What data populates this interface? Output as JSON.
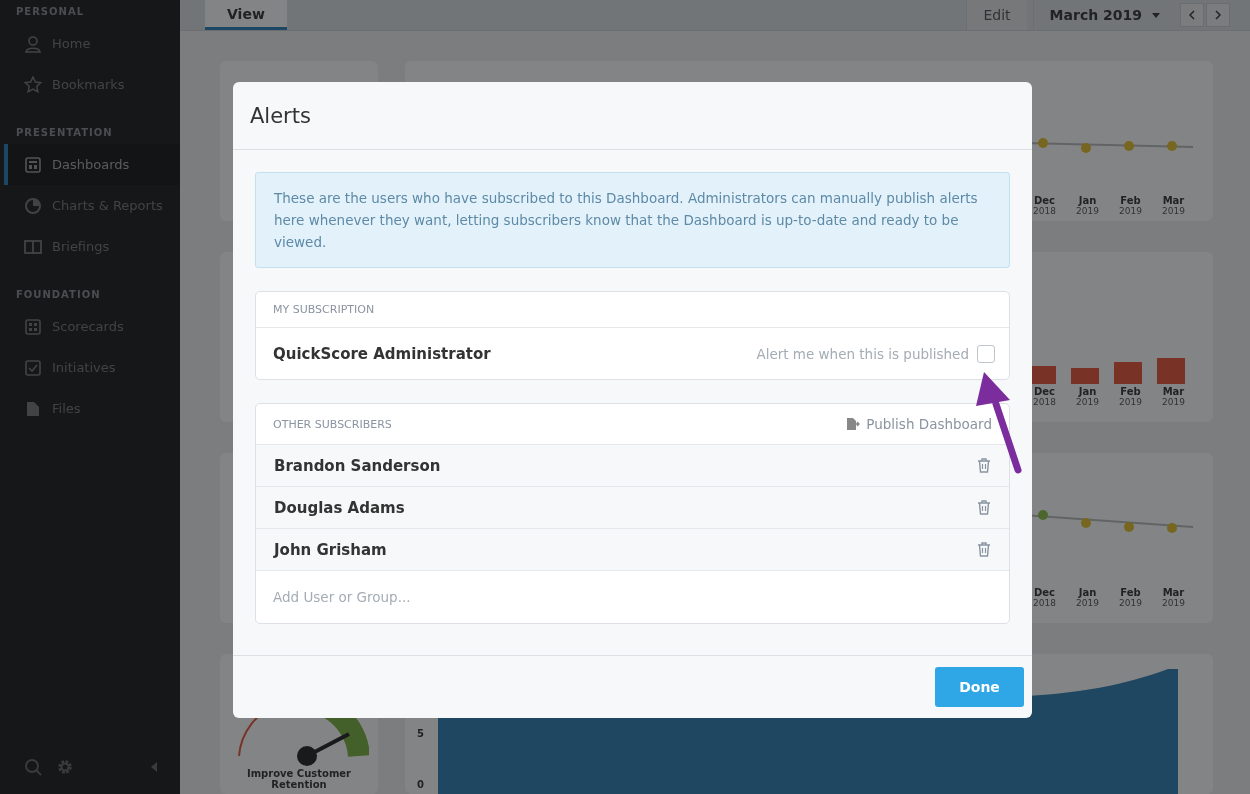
{
  "sidebar": {
    "sections": [
      {
        "title": "PERSONAL",
        "items": [
          {
            "label": "Home",
            "selected": false
          },
          {
            "label": "Bookmarks",
            "selected": false
          }
        ]
      },
      {
        "title": "PRESENTATION",
        "items": [
          {
            "label": "Dashboards",
            "selected": true
          },
          {
            "label": "Charts & Reports",
            "selected": false
          },
          {
            "label": "Briefings",
            "selected": false
          }
        ]
      },
      {
        "title": "FOUNDATION",
        "items": [
          {
            "label": "Scorecards",
            "selected": false
          },
          {
            "label": "Initiatives",
            "selected": false
          },
          {
            "label": "Files",
            "selected": false
          }
        ]
      }
    ]
  },
  "toolbar": {
    "tabs": [
      {
        "label": "View",
        "selected": true
      }
    ],
    "edit_button": "Edit",
    "period": "March 2019"
  },
  "cards": [
    {
      "kind": "line",
      "axis_labels": [
        {
          "month": "Dec",
          "year": "2018"
        },
        {
          "month": "Jan",
          "year": "2019"
        },
        {
          "month": "Feb",
          "year": "2019"
        },
        {
          "month": "Mar",
          "year": "2019"
        }
      ]
    },
    {
      "kind": "bar",
      "axis_labels": [
        {
          "month": "Dec",
          "year": "2018"
        },
        {
          "month": "Jan",
          "year": "2019"
        },
        {
          "month": "Feb",
          "year": "2019"
        },
        {
          "month": "Mar",
          "year": "2019"
        }
      ]
    },
    {
      "kind": "line2",
      "axis_labels": [
        {
          "month": "Dec",
          "year": "2018"
        },
        {
          "month": "Jan",
          "year": "2019"
        },
        {
          "month": "Feb",
          "year": "2019"
        },
        {
          "month": "Mar",
          "year": "2019"
        }
      ]
    },
    {
      "kind": "area",
      "gauge_label": "Improve Customer Retention",
      "y_ticks": [
        "5",
        "0"
      ]
    }
  ],
  "modal": {
    "title": "Alerts",
    "info": "These are the users who have subscribed to this Dashboard. Administrators can manually publish alerts here whenever they want, letting subscribers know that the Dashboard is up-to-date and ready to be viewed.",
    "my_subscription": {
      "heading": "MY SUBSCRIPTION",
      "name": "QuickScore Administrator",
      "alert_label": "Alert me when this is published",
      "checked": false
    },
    "other_subscribers": {
      "heading": "OTHER SUBSCRIBERS",
      "publish_label": "Publish Dashboard",
      "subscribers": [
        "Brandon Sanderson",
        "Douglas Adams",
        "John Grisham"
      ],
      "add_placeholder": "Add User or Group..."
    },
    "done_button": "Done"
  }
}
